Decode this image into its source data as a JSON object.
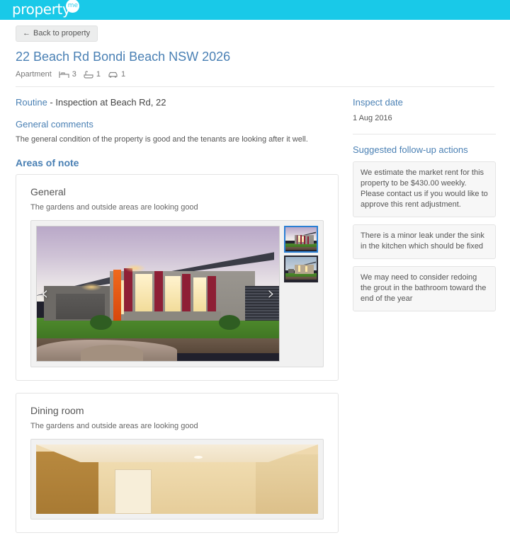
{
  "brand": {
    "logo_word": "property",
    "logo_badge": "me",
    "header_color": "#19c9e8"
  },
  "nav": {
    "back_label": "Back to property",
    "back_arrow": "←"
  },
  "property": {
    "title": "22 Beach Rd Bondi Beach NSW 2026",
    "type": "Apartment",
    "bedrooms": "3",
    "bathrooms": "1",
    "carspaces": "1"
  },
  "inspection": {
    "kind": "Routine",
    "detail": " - Inspection at Beach Rd, 22",
    "general_comments_heading": "General comments",
    "general_comments_text": "The general condition of the property is good and the tenants are looking after it well.",
    "areas_heading": "Areas of note"
  },
  "areas": [
    {
      "title": "General",
      "note": "The gardens and outside areas are looking good",
      "prev_arrow": "‹",
      "next_arrow": "›"
    },
    {
      "title": "Dining room",
      "note": "The gardens and outside areas are looking good"
    }
  ],
  "sidebar": {
    "inspect_date_heading": "Inspect date",
    "inspect_date_value": "1 Aug 2016",
    "actions_heading": "Suggested follow-up actions",
    "actions": [
      "We estimate the market rent for this property to be $430.00 weekly. Please contact us if you would like to approve this rent adjustment.",
      "There is a minor leak under the sink in the kitchen which should be fixed",
      "We may need to consider redoing the grout in the bathroom toward the end of the year"
    ]
  },
  "colors": {
    "link_blue": "#4a80b4",
    "thumb_selected_border": "#2a7fd4"
  }
}
